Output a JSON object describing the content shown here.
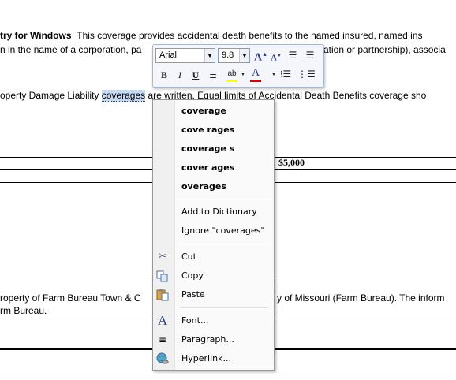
{
  "document": {
    "line1_bold": "try for Windows",
    "line1_rest": "This coverage provides accidental death benefits to the named insured, named ins",
    "line2_left": "n in the name of a corporation, pa",
    "line2_right": "ation or partnership), associa",
    "line3_pre": "operty Damage Liability",
    "line3_word": "coverages",
    "line3_post": "are written. Equal limits of Accidental Death Benefits coverage sho",
    "table_value": "$5,000",
    "line4_left": "roperty of Farm Bureau Town & C",
    "line4_right": "y of Missouri (Farm Bureau).  The inform",
    "line5": "rm Bureau."
  },
  "mini_toolbar": {
    "font_name": "Arial",
    "font_size": "9.8",
    "grow_font": "A",
    "shrink_font": "A",
    "bold": "B",
    "italic": "I",
    "underline": "U",
    "highlight": "ab",
    "font_color": "A"
  },
  "context_menu": {
    "suggestions": [
      "coverage",
      "cove rages",
      "coverage s",
      "cover ages",
      "overages"
    ],
    "add_to_dictionary": "Add to Dictionary",
    "ignore": "Ignore \"coverages\"",
    "cut": "Cut",
    "copy": "Copy",
    "paste": "Paste",
    "font": "Font...",
    "paragraph": "Paragraph...",
    "hyperlink": "Hyperlink..."
  },
  "icons": {
    "cut": "scissors-icon",
    "copy": "copy-icon",
    "paste": "paste-icon",
    "font": "font-icon",
    "paragraph": "paragraph-icon",
    "hyperlink": "hyperlink-icon"
  },
  "colors": {
    "selection_highlight": "#c7daf2",
    "font_color_bar": "#e00000",
    "highlight_bar": "#ffff00"
  }
}
